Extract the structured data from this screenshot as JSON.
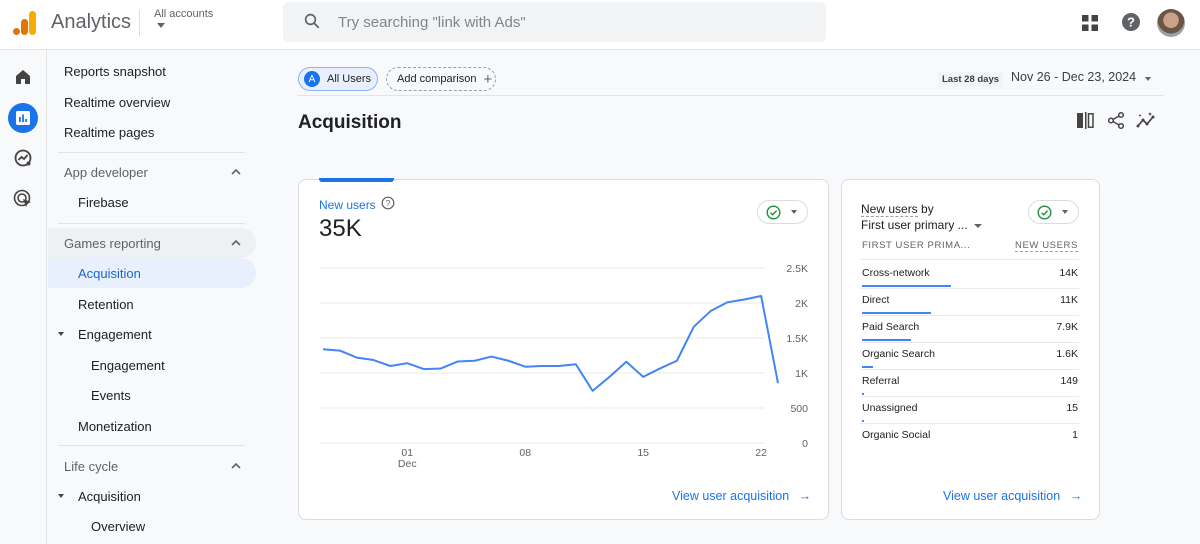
{
  "topbar": {
    "app_name": "Analytics",
    "account_selector": "All accounts",
    "search_placeholder": "Try searching \"link with Ads\"",
    "icons": [
      "apps-grid-icon",
      "help-icon",
      "avatar"
    ]
  },
  "rail": {
    "items": [
      {
        "name": "home",
        "icon": "home-icon",
        "active": false
      },
      {
        "name": "reports",
        "icon": "bar-chart-icon",
        "active": true
      },
      {
        "name": "explore",
        "icon": "explore-icon",
        "active": false
      },
      {
        "name": "advertising",
        "icon": "target-cursor-icon",
        "active": false
      }
    ]
  },
  "nav": {
    "items": [
      {
        "label": "Reports snapshot",
        "level": 1
      },
      {
        "label": "Realtime overview",
        "level": 1
      },
      {
        "label": "Realtime pages",
        "level": 1
      },
      {
        "label": "App developer",
        "level": "section",
        "expanded": true
      },
      {
        "label": "Firebase",
        "level": 2
      },
      {
        "label": "Games reporting",
        "level": "section",
        "expanded": true
      },
      {
        "label": "Acquisition",
        "level": 2,
        "active": true
      },
      {
        "label": "Retention",
        "level": 2
      },
      {
        "label": "Engagement",
        "level": 2,
        "expanded": true
      },
      {
        "label": "Engagement",
        "level": 3
      },
      {
        "label": "Events",
        "level": 3
      },
      {
        "label": "Monetization",
        "level": 2
      },
      {
        "label": "Life cycle",
        "level": "section",
        "expanded": true
      },
      {
        "label": "Acquisition",
        "level": 2,
        "expanded": true
      },
      {
        "label": "Overview",
        "level": 3
      }
    ]
  },
  "filters": {
    "segment_initial": "A",
    "segment_label": "All Users",
    "add_comparison": "Add comparison",
    "add_icon": "+"
  },
  "date": {
    "preset": "Last 28 days",
    "range": "Nov 26 - Dec 23, 2024"
  },
  "page": {
    "title": "Acquisition",
    "actions": [
      "compare-columns-icon",
      "share-icon",
      "insights-icon"
    ]
  },
  "new_users_card": {
    "metric_label": "New users",
    "metric_value": "35K",
    "status": "check-icon",
    "link": "View user acquisition",
    "link_arrow": "→"
  },
  "chart_data": {
    "type": "line",
    "title": "New users",
    "xlabel": "",
    "ylabel": "",
    "x": [
      "Nov 26",
      "Nov 27",
      "Nov 28",
      "Nov 29",
      "Nov 30",
      "Dec 01",
      "Dec 02",
      "Dec 03",
      "Dec 04",
      "Dec 05",
      "Dec 06",
      "Dec 07",
      "Dec 08",
      "Dec 09",
      "Dec 10",
      "Dec 11",
      "Dec 12",
      "Dec 13",
      "Dec 14",
      "Dec 15",
      "Dec 16",
      "Dec 17",
      "Dec 18",
      "Dec 19",
      "Dec 20",
      "Dec 21",
      "Dec 22",
      "Dec 23"
    ],
    "series": [
      {
        "name": "New users",
        "color": "#4285f4",
        "values": [
          1340,
          1320,
          1220,
          1185,
          1100,
          1140,
          1055,
          1065,
          1165,
          1175,
          1235,
          1175,
          1090,
          1100,
          1100,
          1125,
          745,
          945,
          1160,
          945,
          1065,
          1175,
          1660,
          1885,
          2010,
          2050,
          2100,
          855
        ]
      }
    ],
    "ylim": [
      0,
      2500
    ],
    "yticks": [
      0,
      500,
      1000,
      1500,
      2000,
      2500
    ],
    "ytick_labels": [
      "0",
      "500",
      "1K",
      "1.5K",
      "2K",
      "2.5K"
    ],
    "xtick_labels": [
      {
        "index": 5,
        "label": "01",
        "sub": "Dec"
      },
      {
        "index": 12,
        "label": "08",
        "sub": ""
      },
      {
        "index": 19,
        "label": "15",
        "sub": ""
      },
      {
        "index": 26,
        "label": "22",
        "sub": ""
      }
    ],
    "grid": true,
    "y_axis_side": "right"
  },
  "breakdown_card": {
    "title_metric": "New users",
    "title_by": " by",
    "dimension": "First user primary ...",
    "col_dimension": "FIRST USER PRIMA...",
    "col_metric": "NEW USERS",
    "rows": [
      {
        "label": "Cross-network",
        "value": "14K",
        "share": 1.0
      },
      {
        "label": "Direct",
        "value": "11K",
        "share": 0.77
      },
      {
        "label": "Paid Search",
        "value": "7.9K",
        "share": 0.55
      },
      {
        "label": "Organic Search",
        "value": "1.6K",
        "share": 0.12
      },
      {
        "label": "Referral",
        "value": "149",
        "share": 0.01
      },
      {
        "label": "Unassigned",
        "value": "15",
        "share": 0.005
      },
      {
        "label": "Organic Social",
        "value": "1",
        "share": 0.0
      }
    ],
    "link": "View user acquisition",
    "link_arrow": "→"
  }
}
